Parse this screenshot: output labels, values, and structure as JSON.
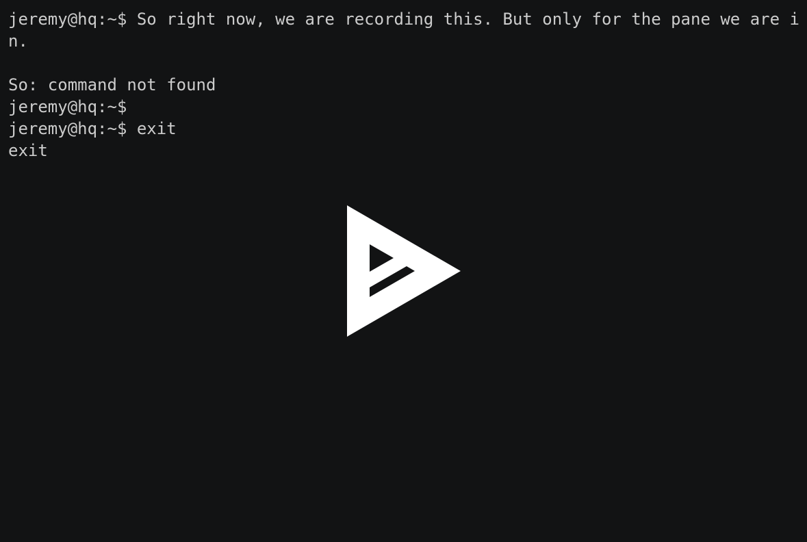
{
  "terminal": {
    "lines": [
      "jeremy@hq:~$ So right now, we are recording this. But only for the pane we are i",
      "n.",
      "",
      "So: command not found",
      "jeremy@hq:~$ ",
      "jeremy@hq:~$ exit",
      "exit"
    ],
    "text_color": "#cccccc",
    "background": "#121314"
  },
  "player": {
    "play_button_icon": "asciinema-play-icon",
    "icon_color": "#ffffff"
  }
}
